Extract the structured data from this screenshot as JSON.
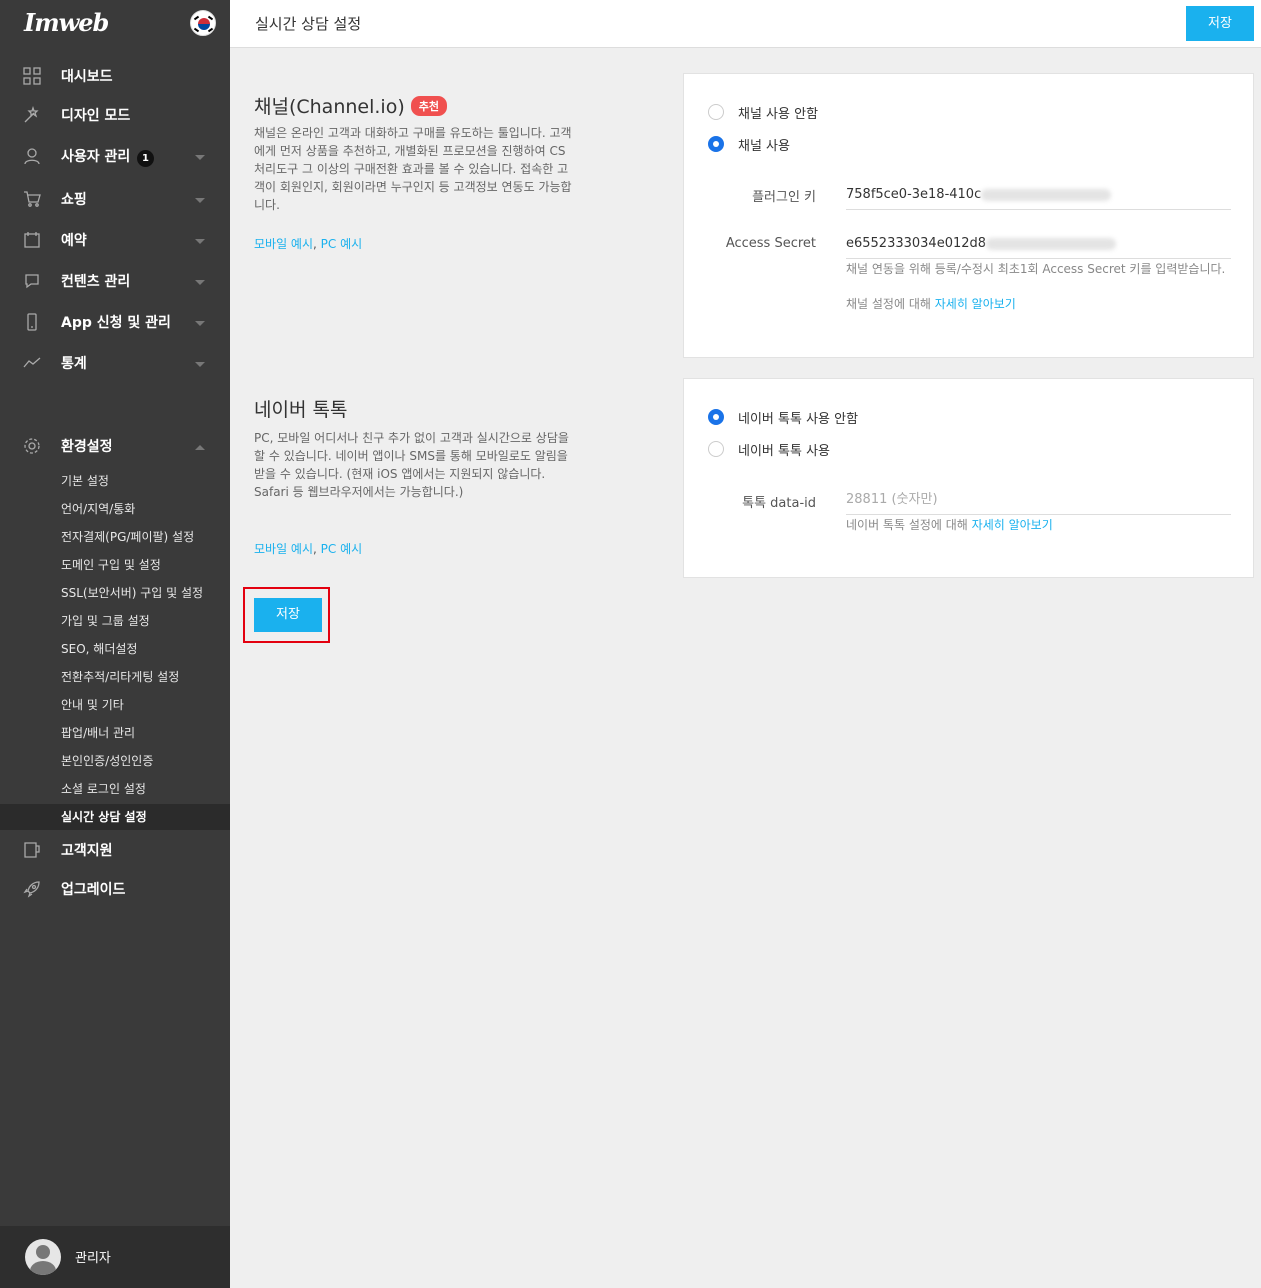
{
  "app": {
    "logo": "Imweb"
  },
  "sidebar": {
    "items": [
      {
        "label": "대시보드",
        "icon": "dashboard-icon"
      },
      {
        "label": "디자인 모드",
        "icon": "design-icon"
      },
      {
        "label": "사용자 관리",
        "icon": "user-icon",
        "badge": "1"
      },
      {
        "label": "쇼핑",
        "icon": "cart-icon"
      },
      {
        "label": "예약",
        "icon": "calendar-icon"
      },
      {
        "label": "컨텐츠 관리",
        "icon": "chat-icon"
      },
      {
        "label": "App 신청 및 관리",
        "icon": "mobile-icon"
      },
      {
        "label": "통계",
        "icon": "chart-icon"
      },
      {
        "label": "환경설정",
        "icon": "gear-icon"
      },
      {
        "label": "고객지원",
        "icon": "support-icon"
      },
      {
        "label": "업그레이드",
        "icon": "rocket-icon"
      }
    ],
    "settings_sub": [
      "기본 설정",
      "언어/지역/통화",
      "전자결제(PG/페이팔) 설정",
      "도메인 구입 및 설정",
      "SSL(보안서버) 구입 및 설정",
      "가입 및 그룹 설정",
      "SEO, 해더설정",
      "전환추적/리타게팅 설정",
      "안내 및 기타",
      "팝업/배너 관리",
      "본인인증/성인인증",
      "소셜 로그인 설정",
      "실시간 상담 설정"
    ],
    "profile_name": "관리자"
  },
  "header": {
    "title": "실시간 상담 설정",
    "save_label": "저장"
  },
  "channel": {
    "title": "채널(Channel.io)",
    "badge": "추천",
    "description": "채널은 온라인 고객과 대화하고 구매를 유도하는 툴입니다. 고객에게 먼저 상품을 추천하고, 개별화된 프로모션을 진행하여 CS처리도구 그 이상의 구매전환 효과를 볼 수 있습니다. 접속한 고객이 회원인지, 회원이라면 누구인지 등 고객정보 연동도 가능합니다.",
    "link_mobile": "모바일 예시",
    "link_sep": ", ",
    "link_pc": "PC 예시",
    "option_off": "채널 사용 안함",
    "option_on": "채널 사용",
    "plugin_label": "플러그인 키",
    "plugin_value": "758f5ce0-3e18-410c",
    "secret_label": "Access Secret",
    "secret_value": "e6552333034e012d8",
    "help1": "채널 연동을 위해 등록/수정시 최초1회 Access Secret 키를 입력받습니다.",
    "help2_prefix": "채널 설정에 대해 ",
    "help2_link": "자세히 알아보기"
  },
  "naver": {
    "title": "네이버 톡톡",
    "description": "PC, 모바일 어디서나 친구 추가 없이 고객과 실시간으로 상담을 할 수 있습니다. 네이버 앱이나 SMS를 통해 모바일로도 알림을 받을 수 있습니다. (현재 iOS 앱에서는 지원되지 않습니다. Safari 등 웹브라우저에서는 가능합니다.)",
    "link_mobile": "모바일 예시",
    "link_sep": ", ",
    "link_pc": "PC 예시",
    "option_off": "네이버 톡톡 사용 안함",
    "option_on": "네이버 톡톡 사용",
    "id_label": "톡톡 data-id",
    "id_placeholder": "28811 (숫자만)",
    "help_prefix": "네이버 톡톡 설정에 대해 ",
    "help_link": "자세히 알아보기"
  },
  "main": {
    "save_label": "저장"
  },
  "colors": {
    "accent": "#1ab1ee",
    "sidebar": "#3a3a3a",
    "badge_red": "#f0504f",
    "radio": "#1a73e8",
    "highlight": "#e3000f"
  }
}
